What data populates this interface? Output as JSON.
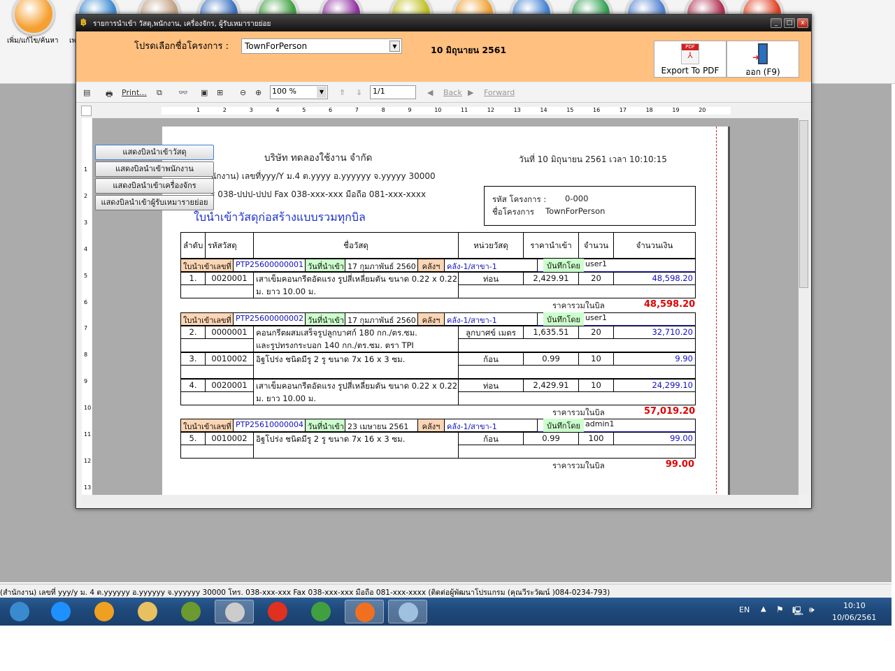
{
  "app": {
    "top_label": "เพิ่ม/แก้ไข/ค้นหา",
    "top_label2": "เพ"
  },
  "window": {
    "title": "รายการนำเข้า วัสดุ,พนักงาน, เครื่องจักร, ผู้รับเหมารายย่อย",
    "minimize": "_",
    "maximize": "□",
    "close": "x"
  },
  "header": {
    "project_label": "โปรดเลือกชื่อโครงการ :",
    "project_value": "TownForPerson",
    "date": "10 มิถุนายน 2561",
    "export_pdf": "Export To PDF",
    "exit": "ออก (F9)"
  },
  "toolbar": {
    "print": "Print...",
    "zoom": "100 %",
    "page": "1/1",
    "back": "Back",
    "forward": "Forward"
  },
  "side_buttons": [
    "แสดงบิลนำเข้าวัสดุ",
    "แสดงบิลนำเข้าพนักงาน",
    "แสดงบิลนำเข้าเครื่องจักร",
    "แสดงบิลนำเข้าผู้รับเหมารายย่อย"
  ],
  "report": {
    "company": "บริษัท ทดลองใช้งาน จำกัด",
    "address": "นักงาน) เลขที่yyy/Y ม.4 ต.yyyy อ.yyyyyy จ.yyyyy 30000",
    "phone": "ร 038-ปปป-ปปป Fax 038-xxx-xxx มือถือ 081-xxx-xxxx",
    "title": "ใบนำเข้าวัสดุก่อสร้างแบบรวมทุกบิล",
    "datetime": "วันที่  10 มิถุนายน 2561   เวลา   10:10:15",
    "project_code_label": "รหัส โครงการ :",
    "project_code": "0-000",
    "project_name_label": "ชื่อโครงการ",
    "project_name": "TownForPerson",
    "columns": [
      "ลำดับ",
      "รหัสวัสดุ",
      "ชื่อวัสดุ",
      "หน่วยวัสดุ",
      "ราคานำเข้า",
      "จำนวน",
      "จำนวนเงิน"
    ],
    "bill_labels": {
      "no": "ใบนำเข้าเลขที่",
      "date": "วันที่นำเข้า",
      "store": "คลังฯ",
      "by": "บันทึกโดย",
      "total": "ราคารวมในบิล"
    },
    "bills": [
      {
        "no": "PTP25600000001",
        "date": "17 กุมภาพันธ์ 2560",
        "store": "คลัง-1/สาขา-1",
        "by": "user1",
        "total": "48,598.20",
        "items": [
          {
            "seq": "1.",
            "code": "0020001",
            "name": "เสาเข็มคอนกรีตอัดแรง รูปสี่เหลี่ยมตัน ขนาด 0.22 x 0.22",
            "name2": "ม. ยาว 10.00 ม.",
            "unit": "ท่อน",
            "price": "2,429.91",
            "qty": "20",
            "amount": "48,598.20"
          }
        ]
      },
      {
        "no": "PTP25600000002",
        "date": "17 กุมภาพันธ์ 2560",
        "store": "คลัง-1/สาขา-1",
        "by": "user1",
        "total": "57,019.20",
        "items": [
          {
            "seq": "2.",
            "code": "0000001",
            "name": "คอนกรีตผสมเสร็จรูปลูกบาศก์ 180 กก./ตร.ซม.",
            "name2": "และรูปทรงกระบอก 140 กก./ตร.ซม. ตรา TPI",
            "unit": "ลูกบาศข์ เมตร",
            "price": "1,635.51",
            "qty": "20",
            "amount": "32,710.20"
          },
          {
            "seq": "3.",
            "code": "0010002",
            "name": "อิฐโปร่ง ชนิดมีรู 2 รู ขนาด 7x 16 x 3 ซม.",
            "name2": "",
            "unit": "ก้อน",
            "price": "0.99",
            "qty": "10",
            "amount": "9.90"
          },
          {
            "seq": "4.",
            "code": "0020001",
            "name": "เสาเข็มคอนกรีตอัดแรง รูปสี่เหลี่ยมตัน ขนาด 0.22 x 0.22",
            "name2": "ม. ยาว 10.00 ม.",
            "unit": "ท่อน",
            "price": "2,429.91",
            "qty": "10",
            "amount": "24,299.10"
          }
        ]
      },
      {
        "no": "PTP25610000004",
        "date": "23 เมษายน 2561",
        "store": "คลัง-1/สาขา-1",
        "by": "admin1",
        "total": "99.00",
        "items": [
          {
            "seq": "5.",
            "code": "0010002",
            "name": "อิฐโปร่ง ชนิดมีรู 2 รู ขนาด 7x 16 x 3 ซม.",
            "name2": "",
            "unit": "ก้อน",
            "price": "0.99",
            "qty": "100",
            "amount": "99.00"
          }
        ]
      }
    ]
  },
  "status_bar": "(สำนักงาน) เลขที่ yyy/y ม. 4 ต.yyyyyy อ.yyyyyy จ.yyyyyy 30000 โทร. 038-xxx-xxx Fax 038-xxx-xxx มือถือ 081-xxx-xxxx (ติดต่อผู้พัฒนาโปรแกรม (คุณวีระวัฒน์ )084-0234-793)",
  "taskbar": {
    "lang": "EN",
    "time": "10:10",
    "date": "10/06/2561",
    "apps": [
      "start",
      "internet-explorer",
      "app-orange",
      "file-explorer",
      "hs-app",
      "report-app",
      "app-red",
      "chrome",
      "firefox",
      "paint"
    ]
  },
  "colors": {
    "orange_panel": "#ffc080",
    "label_orange": "#fcd5b4",
    "label_green": "#ccffcc",
    "total_red": "#e00000",
    "link_blue": "#1010c0"
  }
}
